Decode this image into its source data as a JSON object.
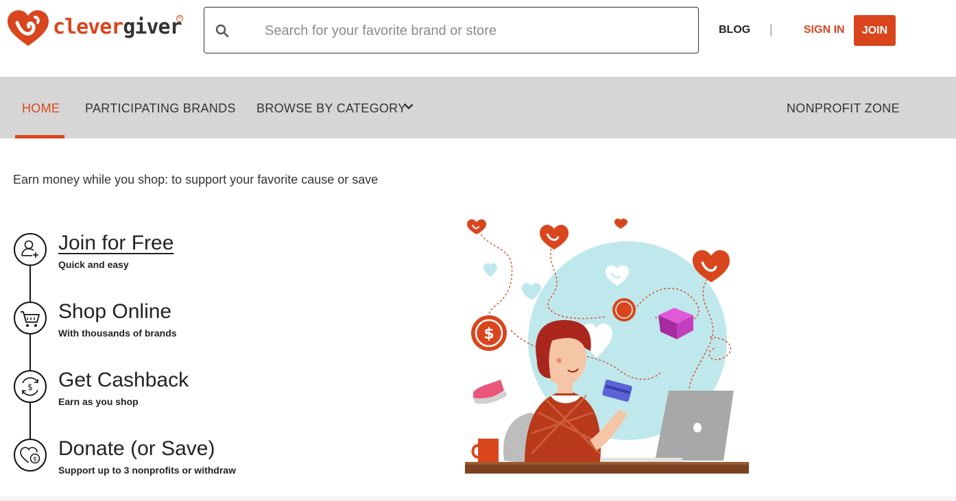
{
  "brand": {
    "name_part1": "clever",
    "name_part2": "giver",
    "registered": "®",
    "accent_color": "#d9451d"
  },
  "search": {
    "placeholder": "Search for your favorite brand or store",
    "value": ""
  },
  "header_links": {
    "blog": "BLOG",
    "separator": "|",
    "sign_in": "SIGN IN",
    "join": "JOIN"
  },
  "nav": {
    "items": [
      {
        "label": "HOME",
        "active": true
      },
      {
        "label": "PARTICIPATING BRANDS"
      },
      {
        "label": "BROWSE BY CATEGORY",
        "icon": "chevron-down-icon"
      },
      {
        "label": "NONPROFIT ZONE"
      }
    ]
  },
  "main": {
    "tagline": "Earn money while you shop: to support your favorite cause or save",
    "steps": [
      {
        "title": "Join for Free",
        "subtitle": "Quick and easy",
        "icon": "add-user-icon"
      },
      {
        "title": "Shop Online",
        "subtitle": "With thousands of brands",
        "icon": "shopping-cart-icon"
      },
      {
        "title": "Get Cashback",
        "subtitle": "Earn as you shop",
        "icon": "cashback-icon"
      },
      {
        "title": "Donate (or Save)",
        "subtitle": "Support up to 3 nonprofits or withdraw",
        "icon": "heart-donation-icon"
      }
    ]
  }
}
